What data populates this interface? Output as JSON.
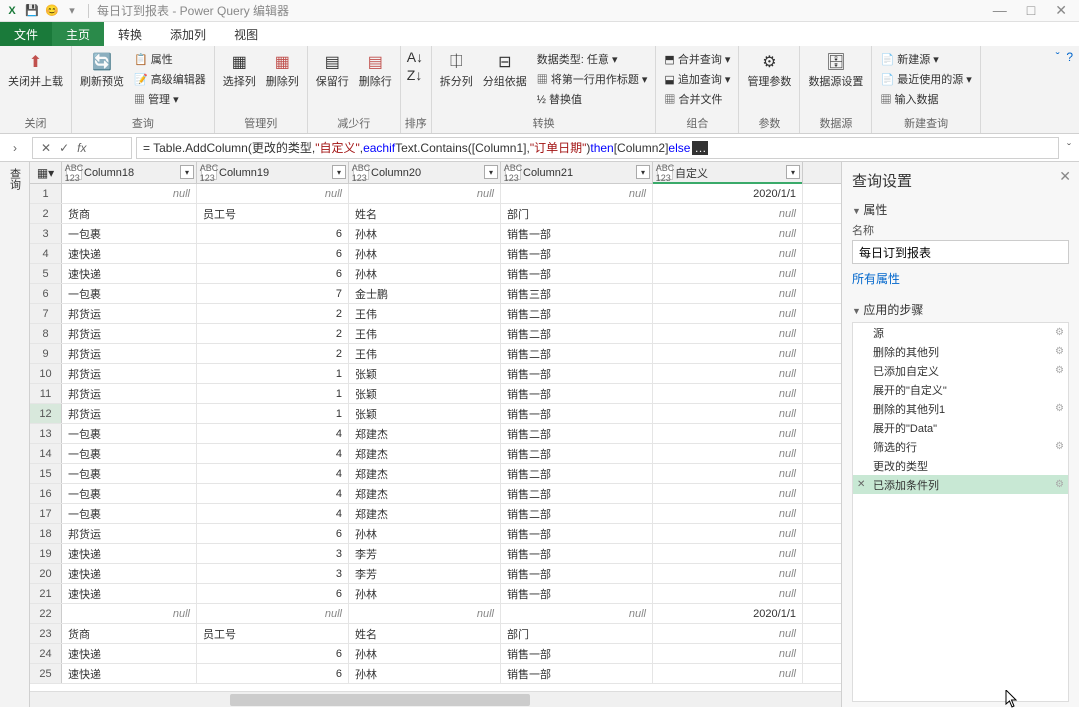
{
  "title": "每日订到报表 - Power Query 编辑器",
  "win_controls": {
    "min": "—",
    "max": "□",
    "close": "✕"
  },
  "menu": {
    "file": "文件",
    "home": "主页",
    "transform": "转换",
    "addcol": "添加列",
    "view": "视图"
  },
  "ribbon": {
    "close_group": {
      "close_load": "关闭并上载",
      "label": "关闭"
    },
    "query_group": {
      "refresh": "刷新预览",
      "props": "属性",
      "adv": "高级编辑器",
      "manage": "管理",
      "label": "查询"
    },
    "managecol_group": {
      "select": "选择列",
      "remove": "删除列",
      "label": "管理列"
    },
    "reducerow_group": {
      "keep": "保留行",
      "delete": "删除行",
      "label": "减少行"
    },
    "sort_group": {
      "label": "排序"
    },
    "transform_group": {
      "split": "拆分列",
      "group": "分组依据",
      "datatype": "数据类型: 任意",
      "firstrow": "将第一行用作标题",
      "replace": "替换值",
      "label": "转换"
    },
    "combine_group": {
      "merge": "合并查询",
      "append": "追加查询",
      "combinefiles": "合并文件",
      "label": "组合"
    },
    "param_group": {
      "manage_param": "管理参数",
      "label": "参数"
    },
    "ds_group": {
      "ds_settings": "数据源设置",
      "label": "数据源"
    },
    "new_group": {
      "new_source": "新建源",
      "recent": "最近使用的源",
      "input": "输入数据",
      "label": "新建查询"
    }
  },
  "formula": {
    "prefix": "= Table.AddColumn(更改的类型, ",
    "arg2": "\"自定义\"",
    "mid": ", ",
    "kw_each": "each",
    "kw_if": " if ",
    "fn": "Text.Contains([Column1], ",
    "arg3": "\"订单日期\"",
    "after": ") ",
    "kw_then": "then",
    "then_body": " [Column2] ",
    "kw_else": "else",
    "more": "…"
  },
  "columns": {
    "c18": "Column18",
    "c19": "Column19",
    "c20": "Column20",
    "c21": "Column21",
    "custom": "自定义",
    "type_abc": "ABC\n123"
  },
  "null_text": "null",
  "rows": [
    {
      "n": 1,
      "c18": null,
      "c19": null,
      "c20": null,
      "c21": null,
      "cust": "2020/1/1"
    },
    {
      "n": 2,
      "c18": "货商",
      "c19": "员工号",
      "c20": "姓名",
      "c21": "部门",
      "cust": null
    },
    {
      "n": 3,
      "c18": "一包裹",
      "c19": "6",
      "c20": "孙林",
      "c21": "销售一部",
      "cust": null
    },
    {
      "n": 4,
      "c18": "速快递",
      "c19": "6",
      "c20": "孙林",
      "c21": "销售一部",
      "cust": null
    },
    {
      "n": 5,
      "c18": "速快递",
      "c19": "6",
      "c20": "孙林",
      "c21": "销售一部",
      "cust": null
    },
    {
      "n": 6,
      "c18": "一包裹",
      "c19": "7",
      "c20": "金士鹏",
      "c21": "销售三部",
      "cust": null
    },
    {
      "n": 7,
      "c18": "邦货运",
      "c19": "2",
      "c20": "王伟",
      "c21": "销售二部",
      "cust": null
    },
    {
      "n": 8,
      "c18": "邦货运",
      "c19": "2",
      "c20": "王伟",
      "c21": "销售二部",
      "cust": null
    },
    {
      "n": 9,
      "c18": "邦货运",
      "c19": "2",
      "c20": "王伟",
      "c21": "销售二部",
      "cust": null
    },
    {
      "n": 10,
      "c18": "邦货运",
      "c19": "1",
      "c20": "张颖",
      "c21": "销售一部",
      "cust": null
    },
    {
      "n": 11,
      "c18": "邦货运",
      "c19": "1",
      "c20": "张颖",
      "c21": "销售一部",
      "cust": null
    },
    {
      "n": 12,
      "c18": "邦货运",
      "c19": "1",
      "c20": "张颖",
      "c21": "销售一部",
      "cust": null
    },
    {
      "n": 13,
      "c18": "一包裹",
      "c19": "4",
      "c20": "郑建杰",
      "c21": "销售二部",
      "cust": null
    },
    {
      "n": 14,
      "c18": "一包裹",
      "c19": "4",
      "c20": "郑建杰",
      "c21": "销售二部",
      "cust": null
    },
    {
      "n": 15,
      "c18": "一包裹",
      "c19": "4",
      "c20": "郑建杰",
      "c21": "销售二部",
      "cust": null
    },
    {
      "n": 16,
      "c18": "一包裹",
      "c19": "4",
      "c20": "郑建杰",
      "c21": "销售二部",
      "cust": null
    },
    {
      "n": 17,
      "c18": "一包裹",
      "c19": "4",
      "c20": "郑建杰",
      "c21": "销售二部",
      "cust": null
    },
    {
      "n": 18,
      "c18": "邦货运",
      "c19": "6",
      "c20": "孙林",
      "c21": "销售一部",
      "cust": null
    },
    {
      "n": 19,
      "c18": "速快递",
      "c19": "3",
      "c20": "李芳",
      "c21": "销售一部",
      "cust": null
    },
    {
      "n": 20,
      "c18": "速快递",
      "c19": "3",
      "c20": "李芳",
      "c21": "销售一部",
      "cust": null
    },
    {
      "n": 21,
      "c18": "速快递",
      "c19": "6",
      "c20": "孙林",
      "c21": "销售一部",
      "cust": null
    },
    {
      "n": 22,
      "c18": null,
      "c19": null,
      "c20": null,
      "c21": null,
      "cust": "2020/1/1"
    },
    {
      "n": 23,
      "c18": "货商",
      "c19": "员工号",
      "c20": "姓名",
      "c21": "部门",
      "cust": null
    },
    {
      "n": 24,
      "c18": "速快递",
      "c19": "6",
      "c20": "孙林",
      "c21": "销售一部",
      "cust": null
    },
    {
      "n": 25,
      "c18": "速快递",
      "c19": "6",
      "c20": "孙林",
      "c21": "销售一部",
      "cust": null
    }
  ],
  "selected_row": 12,
  "settings": {
    "title": "查询设置",
    "properties": "属性",
    "name_label": "名称",
    "name_value": "每日订到报表",
    "all_props": "所有属性",
    "applied_steps": "应用的步骤",
    "steps": [
      {
        "label": "源",
        "gear": true
      },
      {
        "label": "删除的其他列",
        "gear": true
      },
      {
        "label": "已添加自定义",
        "gear": true
      },
      {
        "label": "展开的\"自定义\"",
        "gear": false
      },
      {
        "label": "删除的其他列1",
        "gear": true
      },
      {
        "label": "展开的\"Data\"",
        "gear": false
      },
      {
        "label": "筛选的行",
        "gear": true
      },
      {
        "label": "更改的类型",
        "gear": false
      },
      {
        "label": "已添加条件列",
        "gear": true,
        "active": true
      }
    ]
  },
  "vlabel": "查询"
}
